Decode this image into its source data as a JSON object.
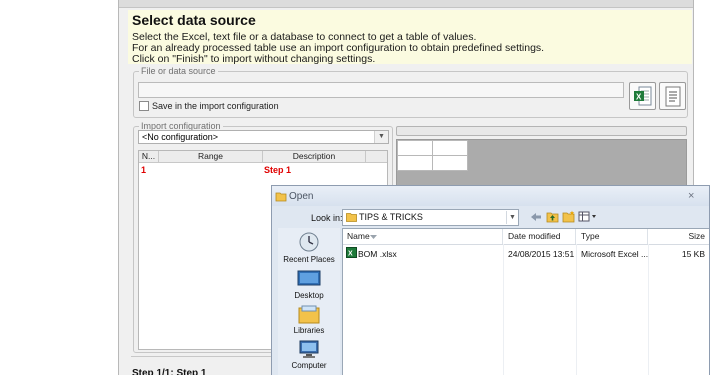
{
  "wizard": {
    "title": "Select data source",
    "instructions": [
      "Select the Excel, text file or a database to connect to get a table of values.",
      "For an already processed table use an import configuration to obtain predefined settings.",
      "Click on \"Finish\" to import without changing settings."
    ],
    "file_group": {
      "legend": "File or data source",
      "value": "",
      "save_label": "Save in the import configuration",
      "save_checked": false
    },
    "import_group": {
      "legend": "Import configuration",
      "selected": "<No configuration>",
      "columns": [
        "N...",
        "Range",
        "Description"
      ],
      "rows": [
        {
          "n": "1",
          "range": "",
          "description": "Step 1"
        }
      ]
    },
    "footer": "Step 1/1: Step 1"
  },
  "open_dialog": {
    "title": "Open",
    "close_glyph": "×",
    "look_in_label": "Look in:",
    "look_in_value": "TIPS & TRICKS",
    "places": [
      {
        "label": "Recent Places",
        "icon": "recent-places-icon"
      },
      {
        "label": "Desktop",
        "icon": "desktop-icon"
      },
      {
        "label": "Libraries",
        "icon": "libraries-icon"
      },
      {
        "label": "Computer",
        "icon": "computer-icon"
      }
    ],
    "columns": {
      "name": "Name",
      "date": "Date modified",
      "type": "Type",
      "size": "Size"
    },
    "files": [
      {
        "name": "BOM .xlsx",
        "date": "24/08/2015 13:51",
        "type": "Microsoft Excel ...",
        "size": "15 KB"
      }
    ]
  },
  "colors": {
    "header_bg": "#fbfbe0",
    "step_red": "#e00000",
    "dialog_bg": "#dfe7f1",
    "preview_gray": "#ababab"
  }
}
